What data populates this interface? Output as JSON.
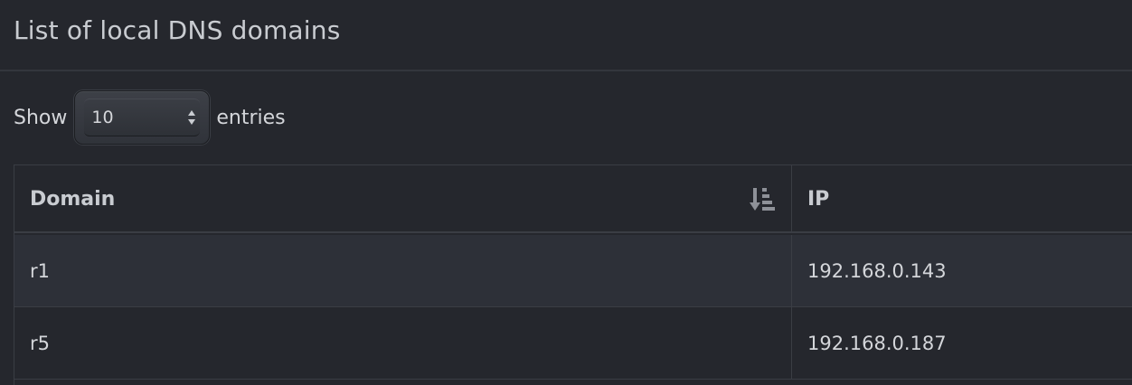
{
  "panel": {
    "title": "List of local DNS domains"
  },
  "length_control": {
    "prefix": "Show",
    "selected": "10",
    "suffix": "entries"
  },
  "table": {
    "columns": [
      {
        "label": "Domain",
        "sort_icon": "sort-amount-down-icon"
      },
      {
        "label": "IP"
      }
    ],
    "rows": [
      {
        "domain": "r1",
        "ip": "192.168.0.143"
      },
      {
        "domain": "r5",
        "ip": "192.168.0.187"
      }
    ]
  },
  "colors": {
    "background": "#25272d",
    "row_alt": "#2d3038",
    "border": "#3a3d44",
    "text": "#d4d6da"
  }
}
